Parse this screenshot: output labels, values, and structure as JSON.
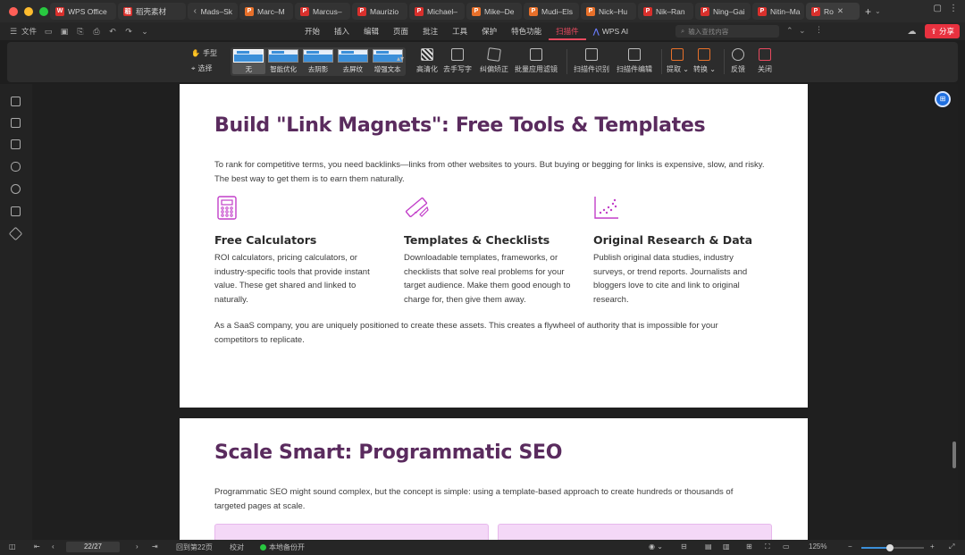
{
  "tabs": [
    {
      "label": "WPS Office",
      "icon": "wps-logo-icon",
      "kind": "w"
    },
    {
      "label": "稻壳素材",
      "icon": "docer-icon",
      "kind": "d"
    },
    {
      "label": "Mads–Sk",
      "icon": "",
      "kind": ""
    },
    {
      "label": "Marc–M",
      "icon": "ppt-icon",
      "kind": "p"
    },
    {
      "label": "Marcus–",
      "icon": "pdf-icon",
      "kind": "r"
    },
    {
      "label": "Maurizio",
      "icon": "pdf-icon",
      "kind": "r"
    },
    {
      "label": "Michael–",
      "icon": "pdf-icon",
      "kind": "r"
    },
    {
      "label": "Mike–De",
      "icon": "ppt-icon",
      "kind": "p"
    },
    {
      "label": "Mudi–Els",
      "icon": "ppt-icon",
      "kind": "p"
    },
    {
      "label": "Nick–Hu",
      "icon": "ppt-icon",
      "kind": "p"
    },
    {
      "label": "Nik–Ran",
      "icon": "pdf-icon",
      "kind": "r"
    },
    {
      "label": "Ning–Gai",
      "icon": "pdf-icon",
      "kind": "r"
    },
    {
      "label": "Nitin–Ma",
      "icon": "pdf-icon",
      "kind": "r"
    },
    {
      "label": "Ro",
      "icon": "pdf-icon",
      "kind": "r",
      "active": true
    }
  ],
  "menubar": {
    "file_label": "文件",
    "tabs": [
      "开始",
      "插入",
      "编辑",
      "页面",
      "批注",
      "工具",
      "保护",
      "特色功能",
      "扫描件",
      "WPS AI"
    ],
    "active_tab": "扫描件",
    "search_placeholder": "输入查找内容",
    "share_label": "分享"
  },
  "ribbon": {
    "hand_label": "手型",
    "select_label": "选择",
    "filters": [
      "无",
      "智能优化",
      "去阴影",
      "去屏纹",
      "增强文本"
    ],
    "selected_filter": "无",
    "filter_thumb_text": "WPS Office",
    "tools": [
      {
        "label": "高清化",
        "icon": "sharpen-icon"
      },
      {
        "label": "去手写字",
        "icon": "remove-handwriting-icon"
      },
      {
        "label": "纠偏矫正",
        "icon": "deskew-icon"
      },
      {
        "label": "批量应用滤镜",
        "icon": "batch-filter-icon"
      },
      {
        "label": "扫描件识别",
        "icon": "scan-recognize-icon"
      },
      {
        "label": "扫描件编辑",
        "icon": "scan-edit-icon"
      },
      {
        "label": "提取",
        "icon": "extract-icon"
      },
      {
        "label": "转换",
        "icon": "convert-icon"
      },
      {
        "label": "反馈",
        "icon": "feedback-icon"
      },
      {
        "label": "关闭",
        "icon": "close-icon"
      }
    ]
  },
  "page1": {
    "title": "Build \"Link Magnets\": Free Tools & Templates",
    "intro": "To rank for competitive terms, you need backlinks—links from other websites to yours. But buying or begging for links is expensive, slow, and risky. The best way to get them is to earn them naturally.",
    "columns": [
      {
        "icon": "calculator-icon",
        "title": "Free Calculators",
        "text": "ROI calculators, pricing calculators, or industry-specific tools that provide instant value. These get shared and linked to naturally."
      },
      {
        "icon": "ruler-pencil-icon",
        "title": "Templates & Checklists",
        "text": "Downloadable templates, frameworks, or checklists that solve real problems for your target audience. Make them good enough to charge for, then give them away."
      },
      {
        "icon": "scatter-chart-icon",
        "title": "Original Research & Data",
        "text": "Publish original data studies, industry surveys, or trend reports. Journalists and bloggers love to cite and link to original research."
      }
    ],
    "closing": "As a SaaS company, you are uniquely positioned to create these assets. This creates a flywheel of authority that is impossible for your competitors to replicate."
  },
  "page2": {
    "title": "Scale Smart: Programmatic SEO",
    "intro": "Programmatic SEO might sound complex, but the concept is simple: using a template-based approach to create hundreds or thousands of targeted pages at scale."
  },
  "statusbar": {
    "page_value": "22/27",
    "back_label": "回到第22页",
    "proof_label": "校对",
    "backup_label": "本地备份开",
    "zoom_label": "125%",
    "zoom_fraction": 0.45
  },
  "colors": {
    "accent": "#e84a5f",
    "heading": "#5a2b5e",
    "icon_magenta": "#c23fc9",
    "box_fill": "#f4d8f7"
  }
}
